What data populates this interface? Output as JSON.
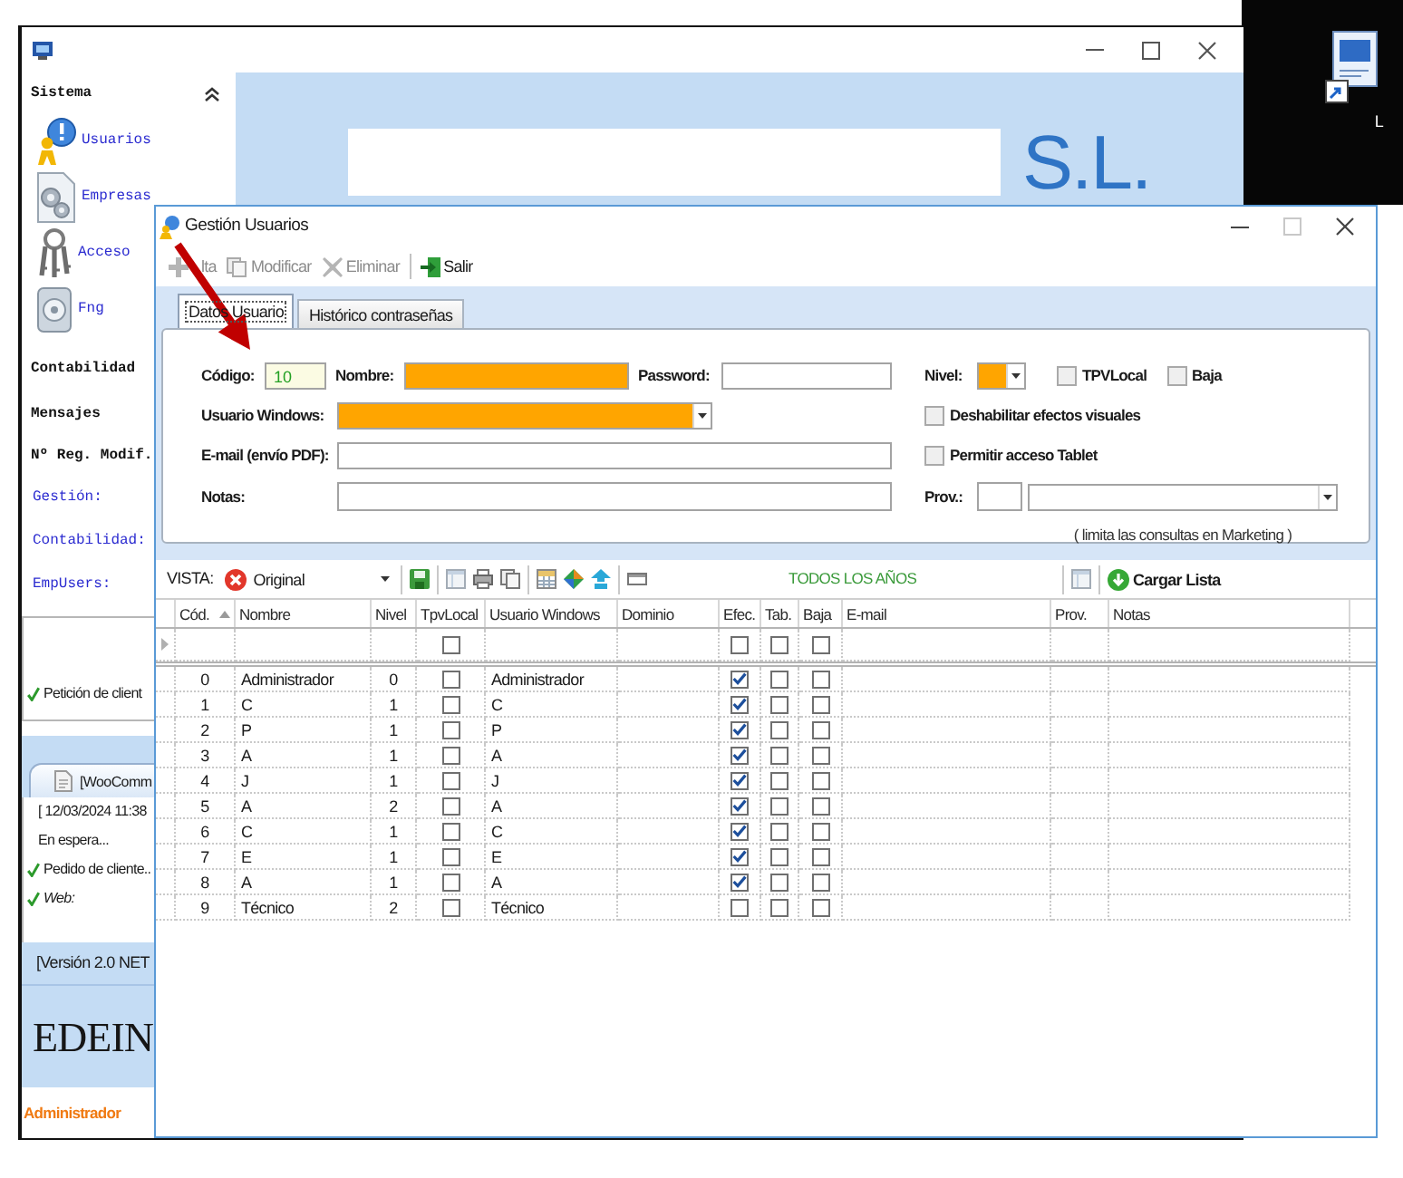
{
  "desktop": {
    "icon_label": "L"
  },
  "main_window": {
    "banner": {
      "company_suffix": "S.L."
    },
    "sidebar": {
      "header": {
        "label": "Sistema",
        "expanded": true
      },
      "items": [
        {
          "label": "Usuarios"
        },
        {
          "label": "Empresas"
        },
        {
          "label": "Acceso"
        },
        {
          "label": "Fng"
        }
      ],
      "sections": [
        {
          "label": "Contabilidad"
        },
        {
          "label": "Mensajes"
        }
      ],
      "counters": {
        "title": "Nº Reg. Modif.",
        "fields": [
          {
            "label": "Gestión:"
          },
          {
            "label": "Contabilidad:"
          },
          {
            "label": "EmpUsers:"
          }
        ]
      }
    },
    "notifications": [
      {
        "text": "Petición de client",
        "ticked": true
      }
    ],
    "orders_panel": {
      "tab": "[WooComm",
      "rows": [
        {
          "kind": "text",
          "text": "[ 12/03/2024 11:38",
          "ticked": false
        },
        {
          "kind": "text",
          "text": "En espera...",
          "ticked": false
        },
        {
          "kind": "text",
          "text": "Pedido de cliente..",
          "ticked": true
        },
        {
          "kind": "field",
          "text": "Web:",
          "ticked": true
        }
      ]
    },
    "version": "[Versión 2.0 NET",
    "logo": "EDEIN",
    "user": "Administrador"
  },
  "dialog": {
    "title": "Gestión Usuarios",
    "toolbar": [
      {
        "label": "lta",
        "disabled": true
      },
      {
        "label": "Modificar",
        "disabled": true
      },
      {
        "label": "Eliminar",
        "disabled": true
      },
      {
        "label": "Salir",
        "disabled": false
      }
    ],
    "tabs": [
      {
        "label": "Datos Usuario",
        "selected": true
      },
      {
        "label": "Histórico contraseñas",
        "selected": false
      }
    ],
    "form": {
      "codigo": {
        "label": "Código:",
        "value": "10",
        "readonly": true
      },
      "nombre": {
        "label": "Nombre:",
        "highlighted": true
      },
      "password": {
        "label": "Password:",
        "highlighted": false
      },
      "nivel": {
        "label": "Nivel:",
        "highlighted": true
      },
      "tpv_local": {
        "label": "TPVLocal",
        "checked": false
      },
      "baja": {
        "label": "Baja",
        "checked": false
      },
      "usuario_windows": {
        "label": "Usuario Windows:",
        "highlighted": true
      },
      "deshabilitar_efectos": {
        "label": "Deshabilitar efectos visuales",
        "checked": false
      },
      "email": {
        "label": "E-mail (envío PDF):",
        "highlighted": false
      },
      "permitir_tablet": {
        "label": "Permitir acceso Tablet",
        "checked": false
      },
      "notas": {
        "label": "Notas:",
        "highlighted": false
      },
      "prov": {
        "label": "Prov.:",
        "hint": "( limita las consultas en Marketing )"
      }
    },
    "view_bar": {
      "label": "VISTA:",
      "view": "Original",
      "year_filter": "TODOS LOS AÑOS",
      "load_button": "Cargar Lista"
    },
    "table": {
      "columns": [
        {
          "label": "Cód.",
          "kind": "number",
          "sorted": true
        },
        {
          "label": "Nombre",
          "kind": "text",
          "sorted": false
        },
        {
          "label": "Nivel",
          "kind": "number",
          "sorted": false
        },
        {
          "label": "TpvLocal",
          "kind": "check",
          "sorted": false
        },
        {
          "label": "Usuario Windows",
          "kind": "text",
          "sorted": false
        },
        {
          "label": "Dominio",
          "kind": "text",
          "sorted": false
        },
        {
          "label": "Efec.",
          "kind": "check",
          "sorted": false
        },
        {
          "label": "Tab.",
          "kind": "check",
          "sorted": false
        },
        {
          "label": "Baja",
          "kind": "check",
          "sorted": false
        },
        {
          "label": "E-mail",
          "kind": "text",
          "sorted": false
        },
        {
          "label": "Prov.",
          "kind": "text",
          "sorted": false
        },
        {
          "label": "Notas",
          "kind": "text",
          "sorted": false
        }
      ],
      "filter_row": {
        "tpvlocal": false,
        "efec": false,
        "tab": false,
        "baja": false
      },
      "rows": [
        {
          "cod": "0",
          "nombre": "Administrador",
          "nivel": "0",
          "tpvlocal": false,
          "usuario_windows": "Administrador",
          "efec": true,
          "tab": false,
          "baja": false
        },
        {
          "cod": "1",
          "nombre": "C",
          "nivel": "1",
          "tpvlocal": false,
          "usuario_windows": "C",
          "efec": true,
          "tab": false,
          "baja": false
        },
        {
          "cod": "2",
          "nombre": "P",
          "nivel": "1",
          "tpvlocal": false,
          "usuario_windows": "P",
          "efec": true,
          "tab": false,
          "baja": false
        },
        {
          "cod": "3",
          "nombre": "A",
          "nivel": "1",
          "tpvlocal": false,
          "usuario_windows": "A",
          "efec": true,
          "tab": false,
          "baja": false
        },
        {
          "cod": "4",
          "nombre": "J",
          "nivel": "1",
          "tpvlocal": false,
          "usuario_windows": "J",
          "efec": true,
          "tab": false,
          "baja": false
        },
        {
          "cod": "5",
          "nombre": "A",
          "nivel": "2",
          "tpvlocal": false,
          "usuario_windows": "A",
          "efec": true,
          "tab": false,
          "baja": false
        },
        {
          "cod": "6",
          "nombre": "C",
          "nivel": "1",
          "tpvlocal": false,
          "usuario_windows": "C",
          "efec": true,
          "tab": false,
          "baja": false
        },
        {
          "cod": "7",
          "nombre": "E",
          "nivel": "1",
          "tpvlocal": false,
          "usuario_windows": "E",
          "efec": true,
          "tab": false,
          "baja": false
        },
        {
          "cod": "8",
          "nombre": "A",
          "nivel": "1",
          "tpvlocal": false,
          "usuario_windows": "A",
          "efec": true,
          "tab": false,
          "baja": false
        },
        {
          "cod": "9",
          "nombre": "Técnico",
          "nivel": "2",
          "tpvlocal": false,
          "usuario_windows": "Técnico",
          "efec": false,
          "tab": false,
          "baja": false
        }
      ]
    }
  }
}
